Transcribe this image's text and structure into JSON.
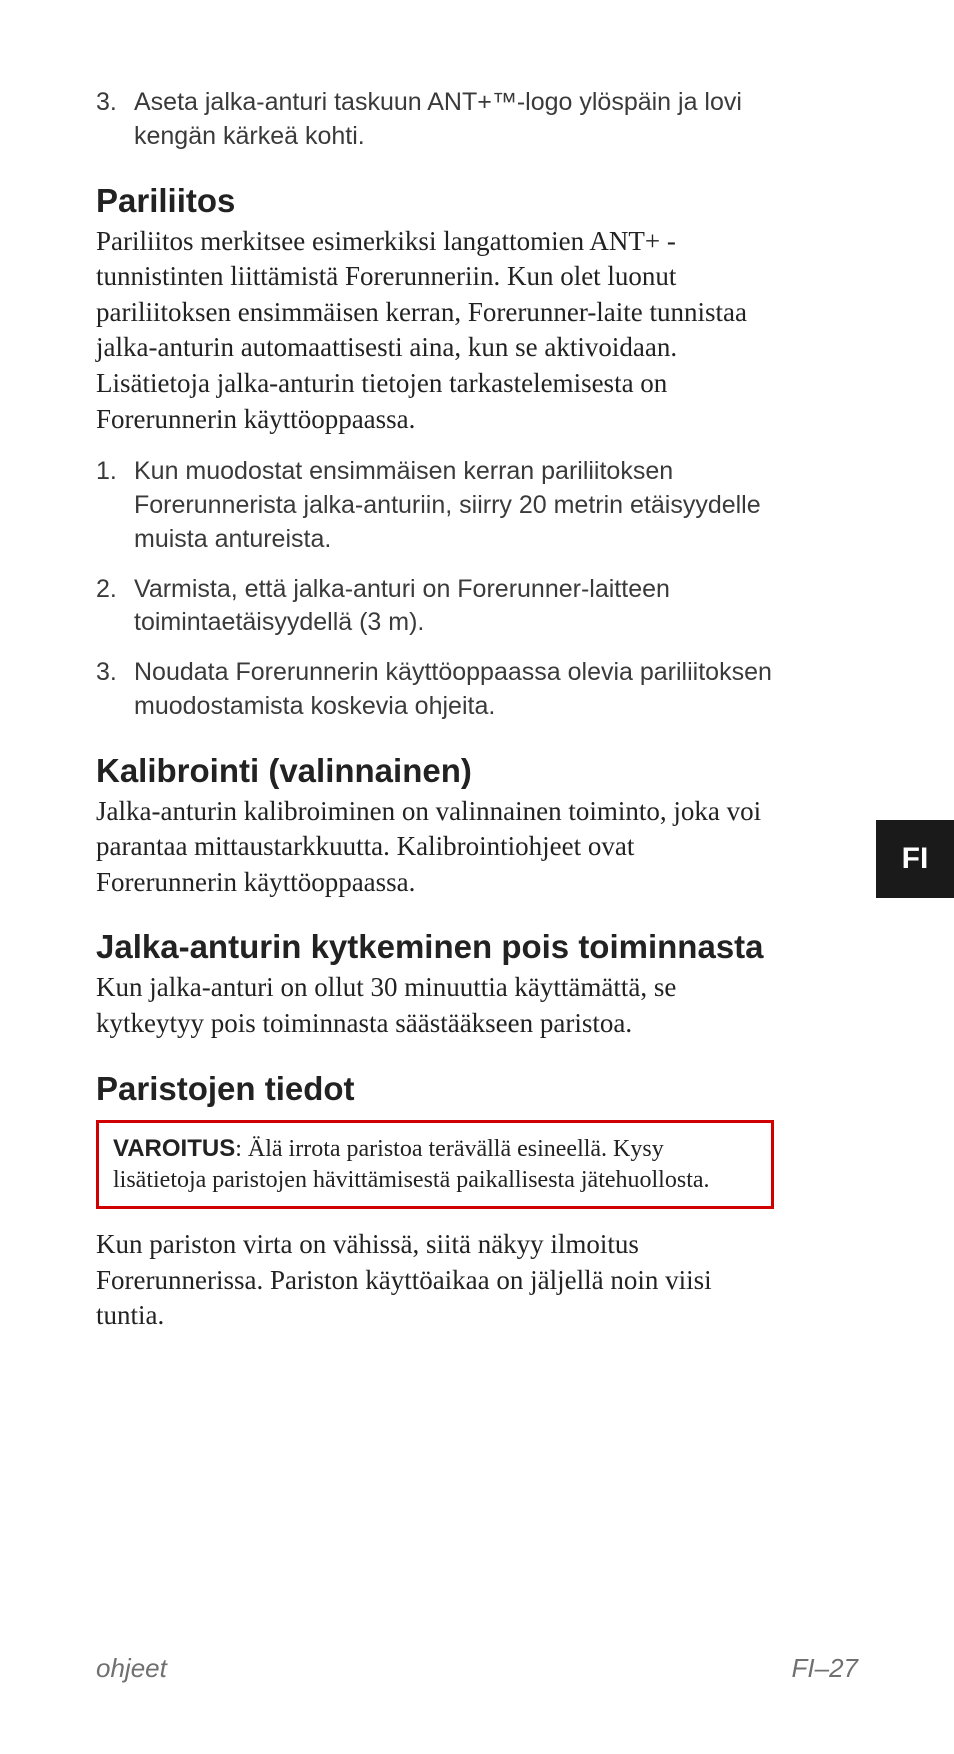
{
  "top_list": {
    "item3_num": "3.",
    "item3_text": "Aseta jalka-anturi taskuun ANT+™-logo ylöspäin ja lovi kengän kärkeä kohti."
  },
  "sections": {
    "pariliitos": {
      "heading": "Pariliitos",
      "body": "Pariliitos merkitsee esimerkiksi langattomien ANT+ -tunnistinten liittämistä Forerunneriin. Kun olet luonut pariliitoksen ensimmäisen kerran, Forerunner-laite tunnistaa jalka-anturin automaattisesti aina, kun se aktivoidaan. Lisätietoja jalka-anturin tietojen tarkastelemisesta on Forerunnerin käyttöoppaassa.",
      "steps": [
        {
          "num": "1.",
          "text": "Kun muodostat ensimmäisen kerran pariliitoksen Forerunnerista jalka-anturiin, siirry 20 metrin etäisyydelle muista antureista."
        },
        {
          "num": "2.",
          "text": "Varmista, että jalka-anturi on Forerunner-laitteen toimintaetäisyydellä (3 m)."
        },
        {
          "num": "3.",
          "text": "Noudata Forerunnerin käyttöoppaassa olevia pariliitoksen muodostamista koskevia ohjeita."
        }
      ]
    },
    "kalibrointi": {
      "heading": "Kalibrointi (valinnainen)",
      "body": "Jalka-anturin kalibroiminen on valinnainen toiminto, joka voi parantaa mittaustarkkuutta. Kalibrointiohjeet ovat Forerunnerin käyttöoppaassa."
    },
    "kytkeminen": {
      "heading": "Jalka-anturin kytkeminen pois toimin­nasta",
      "body": "Kun jalka-anturi on ollut 30 minuuttia käyttämättä, se kytkeytyy pois toiminnasta säästääkseen paristoa."
    },
    "paristojen": {
      "heading": "Paristojen tiedot",
      "warning_label": "VAROITUS",
      "warning_text": ": Älä irrota paristoa terävällä esineellä. Kysy lisätietoja paristojen hävittämisestä paikallisesta jätehuollosta.",
      "body": "Kun pariston virta on vähissä, siitä näkyy ilmoitus Forerunnerissa. Pariston käyttöaikaa on jäljellä noin viisi tuntia."
    }
  },
  "side_tab": "FI",
  "footer": {
    "left": "ohjeet",
    "right": "FI–27"
  }
}
